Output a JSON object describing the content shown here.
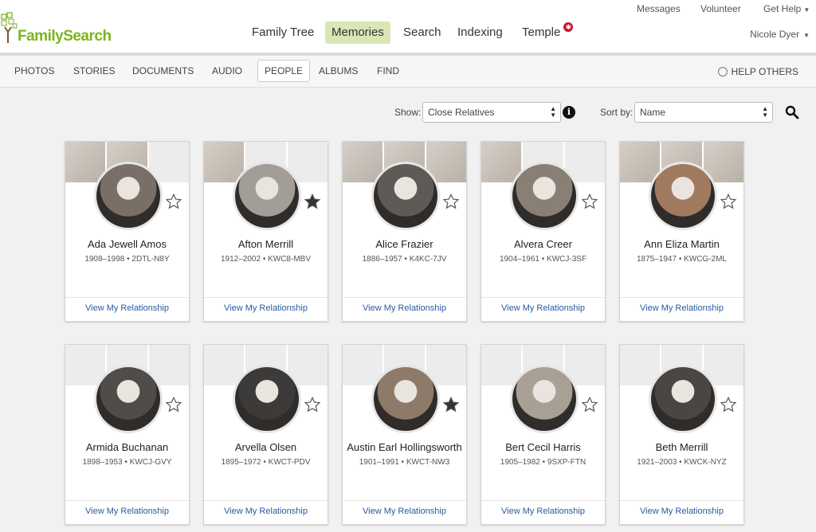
{
  "header": {
    "logo_text": "FamilySearch",
    "utility": {
      "messages": "Messages",
      "volunteer": "Volunteer",
      "get_help": "Get Help"
    },
    "nav": {
      "family_tree": "Family Tree",
      "memories": "Memories",
      "search": "Search",
      "indexing": "Indexing",
      "temple": "Temple"
    },
    "user_name": "Nicole Dyer"
  },
  "subnav": {
    "photos": "PHOTOS",
    "stories": "STORIES",
    "documents": "DOCUMENTS",
    "audio": "AUDIO",
    "people": "PEOPLE",
    "albums": "ALBUMS",
    "find": "FIND",
    "help_others": "HELP OTHERS"
  },
  "filters": {
    "show_label": "Show:",
    "show_value": "Close Relatives",
    "sort_label": "Sort by:",
    "sort_value": "Name"
  },
  "colors": {
    "brand_green": "#7ab51d",
    "active_nav": "#d8e7b5",
    "link_blue": "#2a5a9e",
    "temple_badge": "#c8102e"
  },
  "people": [
    {
      "name": "Ada Jewell Amos",
      "meta": "1908–1998 • 2DTL-N8Y",
      "link": "View My Relationship",
      "starred": false,
      "banner_photos": 2,
      "tone": "#7a6f66"
    },
    {
      "name": "Afton Merrill",
      "meta": "1912–2002 • KWC8-MBV",
      "link": "View My Relationship",
      "starred": true,
      "banner_photos": 1,
      "tone": "#a39d97"
    },
    {
      "name": "Alice Frazier",
      "meta": "1886–1957 • K4KC-7JV",
      "link": "View My Relationship",
      "starred": false,
      "banner_photos": 3,
      "tone": "#5e5a56"
    },
    {
      "name": "Alvera Creer",
      "meta": "1904–1961 • KWCJ-3SF",
      "link": "View My Relationship",
      "starred": false,
      "banner_photos": 1,
      "tone": "#8a7f74"
    },
    {
      "name": "Ann Eliza Martin",
      "meta": "1875–1947 • KWCG-2ML",
      "link": "View My Relationship",
      "starred": false,
      "banner_photos": 3,
      "tone": "#a07a5f"
    },
    {
      "name": "Armida Buchanan",
      "meta": "1898–1953 • KWCJ-GVY",
      "link": "View My Relationship",
      "starred": false,
      "banner_photos": 0,
      "tone": "#4f4c49"
    },
    {
      "name": "Arvella Olsen",
      "meta": "1895–1972 • KWCT-PDV",
      "link": "View My Relationship",
      "starred": false,
      "banner_photos": 0,
      "tone": "#3d3b39"
    },
    {
      "name": "Austin Earl Hollingsworth",
      "meta": "1901–1991 • KWCT-NW3",
      "link": "View My Relationship",
      "starred": true,
      "banner_photos": 0,
      "tone": "#8e7a68"
    },
    {
      "name": "Bert Cecil Harris",
      "meta": "1905–1982 • 9SXP-FTN",
      "link": "View My Relationship",
      "starred": false,
      "banner_photos": 0,
      "tone": "#a8a095"
    },
    {
      "name": "Beth Merrill",
      "meta": "1921–2003 • KWCK-NYZ",
      "link": "View My Relationship",
      "starred": false,
      "banner_photos": 0,
      "tone": "#4a4644"
    }
  ]
}
